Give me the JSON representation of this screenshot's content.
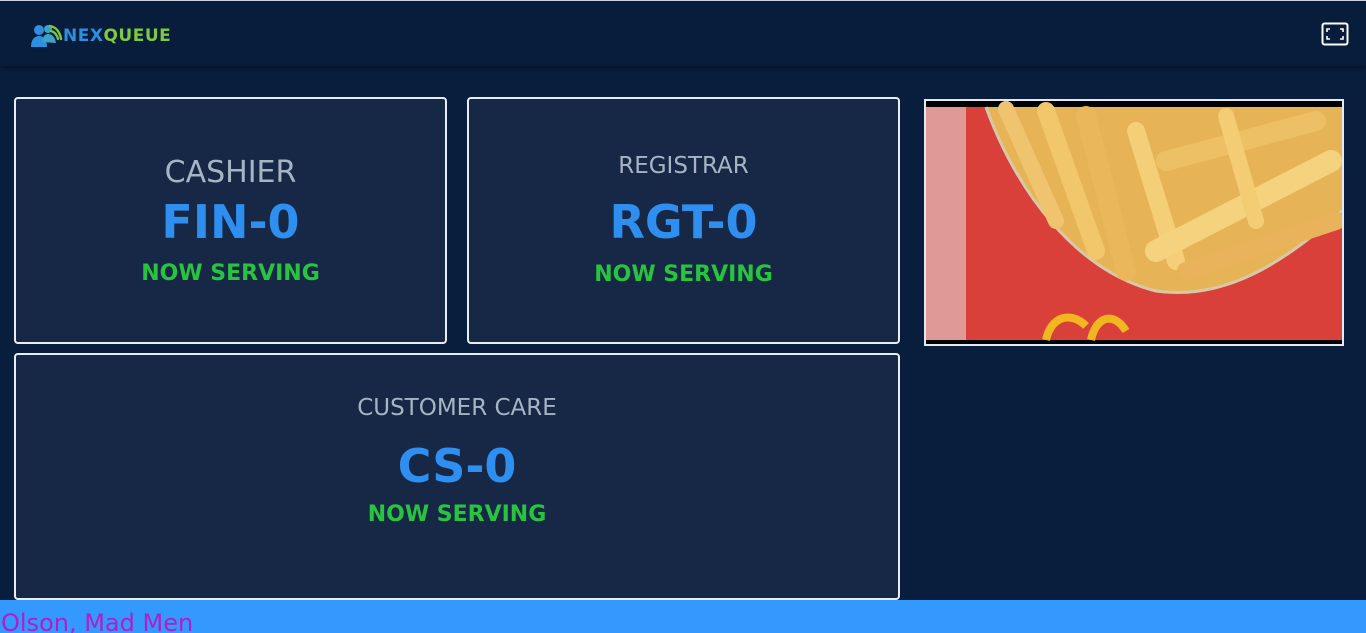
{
  "header": {
    "logo": {
      "icon": "people-queue-icon",
      "text_part1": "NEX",
      "text_part2": "QUEUE"
    },
    "fullscreen_icon": "fullscreen-icon"
  },
  "counters": [
    {
      "name": "CASHIER",
      "ticket": "FIN-0",
      "status": "NOW SERVING"
    },
    {
      "name": "REGISTRAR",
      "ticket": "RGT-0",
      "status": "NOW SERVING"
    },
    {
      "name": "CUSTOMER CARE",
      "ticket": "CS-0",
      "status": "NOW SERVING"
    }
  ],
  "media": {
    "subject": "french fries in red carton"
  },
  "ticker": {
    "text": "Olson, Mad Men"
  },
  "colors": {
    "background": "#091d3d",
    "card": "#162846",
    "ticket": "#2f8ff0",
    "status": "#28c43f",
    "ticker_bar": "#3399ff",
    "ticker_text": "#b01fc4",
    "logo_blue": "#2c8fe0",
    "logo_green": "#7ec93e"
  }
}
